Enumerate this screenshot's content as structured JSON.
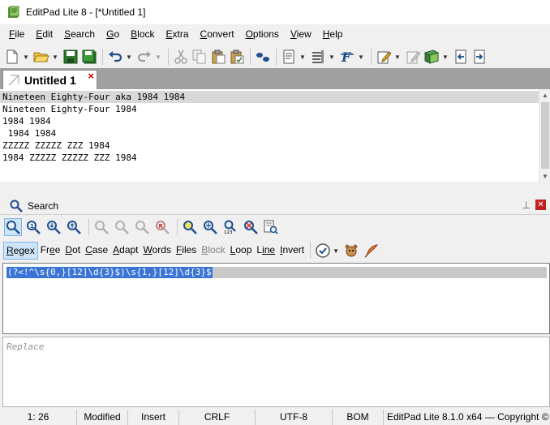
{
  "window": {
    "title": "EditPad Lite 8 - [*Untitled 1]"
  },
  "menu": {
    "items": [
      {
        "u": "F",
        "rest": "ile"
      },
      {
        "u": "E",
        "rest": "dit"
      },
      {
        "u": "S",
        "rest": "earch"
      },
      {
        "u": "G",
        "rest": "o"
      },
      {
        "u": "B",
        "rest": "lock"
      },
      {
        "u": "E",
        "rest": "xtra"
      },
      {
        "u": "C",
        "rest": "onvert"
      },
      {
        "u": "O",
        "rest": "ptions"
      },
      {
        "u": "V",
        "rest": "iew"
      },
      {
        "u": "H",
        "rest": "elp"
      }
    ]
  },
  "tab": {
    "label": "Untitled 1",
    "close": "×"
  },
  "editor": {
    "lines": [
      "Nineteen Eighty-Four aka 1984 1984",
      "Nineteen Eighty-Four 1984",
      "1984 1984",
      " 1984 1984",
      "ZZZZZ ZZZZZ ZZZ 1984",
      "1984 ZZZZZ ZZZZZ ZZZ 1984"
    ]
  },
  "search_panel": {
    "title": "Search",
    "options": [
      {
        "u": "R",
        "rest": "egex",
        "active": true
      },
      {
        "u": "",
        "pre": "Fr",
        "uc": "e",
        "rest": "e"
      },
      {
        "u": "D",
        "rest": "ot"
      },
      {
        "u": "C",
        "rest": "ase"
      },
      {
        "u": "A",
        "rest": "dapt"
      },
      {
        "u": "W",
        "rest": "ords"
      },
      {
        "u": "F",
        "rest": "iles"
      },
      {
        "u": "B",
        "rest": "lock",
        "disabled": true
      },
      {
        "u": "L",
        "rest": "oop"
      },
      {
        "u": "L",
        "rest": "ine",
        "pre_u": true
      },
      {
        "u": "I",
        "rest": "nvert"
      }
    ],
    "search_text": "(?<!^\\s{0,}[12]\\d{3}$)\\s{1,}[12]\\d{3}$",
    "replace_placeholder": "Replace"
  },
  "status": {
    "position": "1: 26",
    "modified": "Modified",
    "mode": "Insert",
    "line_break": "CRLF",
    "encoding": "UTF-8",
    "bom": "BOM",
    "product": "EditPad Lite 8.1.0 x64",
    "copyright": "— Copyright ©"
  },
  "colors": {
    "selection": "#3b74d7",
    "tab_strip": "#a0a0a0",
    "close_red": "#c00000"
  }
}
